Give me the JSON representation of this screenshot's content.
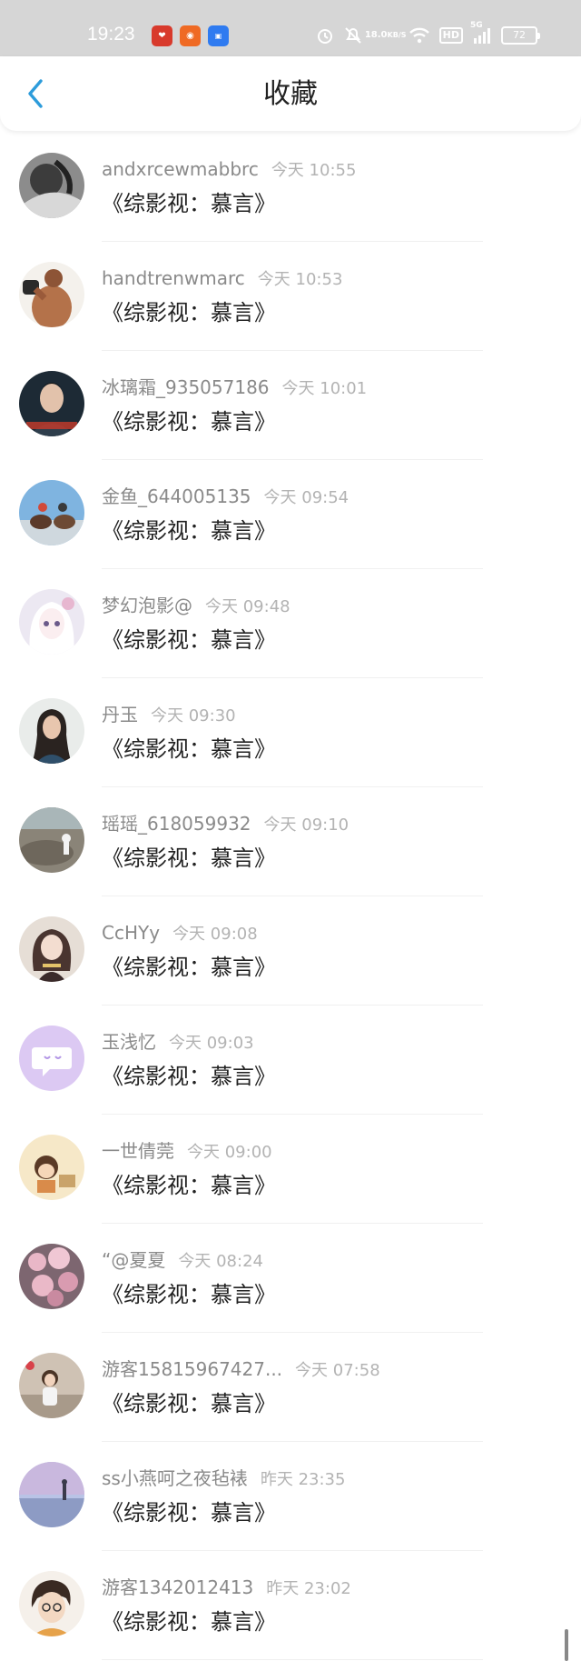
{
  "status_bar": {
    "time": "19:23",
    "net_speed_value": "18.0",
    "net_speed_unit": "KB/S",
    "hd_label": "HD",
    "signal_label": "5G",
    "battery": "72",
    "app_icons": [
      "app-icon-red",
      "app-icon-orange",
      "app-icon-blue"
    ],
    "icons": [
      "alarm-icon",
      "mute-icon",
      "wifi-icon",
      "signal-icon",
      "battery-icon"
    ]
  },
  "header": {
    "title": "收藏",
    "back_icon": "chevron-left-icon",
    "accent_color": "#2d9cdb"
  },
  "list": {
    "items": [
      {
        "name": "andxrcewmabbrc",
        "time": "今天 10:55",
        "content": "《综影视：慕言》"
      },
      {
        "name": "handtrenwmarc",
        "time": "今天 10:53",
        "content": "《综影视：慕言》"
      },
      {
        "name": "冰璃霜_935057186",
        "time": "今天 10:01",
        "content": "《综影视：慕言》"
      },
      {
        "name": "金鱼_644005135",
        "time": "今天 09:54",
        "content": "《综影视：慕言》"
      },
      {
        "name": "梦幻泡影@",
        "time": "今天 09:48",
        "content": "《综影视：慕言》"
      },
      {
        "name": "丹玉",
        "time": "今天 09:30",
        "content": "《综影视：慕言》"
      },
      {
        "name": "瑶瑶_618059932",
        "time": "今天 09:10",
        "content": "《综影视：慕言》"
      },
      {
        "name": "CcHYy",
        "time": "今天 09:08",
        "content": "《综影视：慕言》"
      },
      {
        "name": "玉浅忆",
        "time": "今天 09:03",
        "content": "《综影视：慕言》"
      },
      {
        "name": "一世倩莞",
        "time": "今天 09:00",
        "content": "《综影视：慕言》"
      },
      {
        "name": "“@夏夏",
        "time": "今天 08:24",
        "content": "《综影视：慕言》"
      },
      {
        "name": "游客15815967427...",
        "time": "今天 07:58",
        "content": "《综影视：慕言》"
      },
      {
        "name": "ss小燕呵之夜毡裱",
        "time": "昨天 23:35",
        "content": "《综影视：慕言》"
      },
      {
        "name": "游客1342012413",
        "time": "昨天 23:02",
        "content": "《综影视：慕言》"
      }
    ]
  }
}
